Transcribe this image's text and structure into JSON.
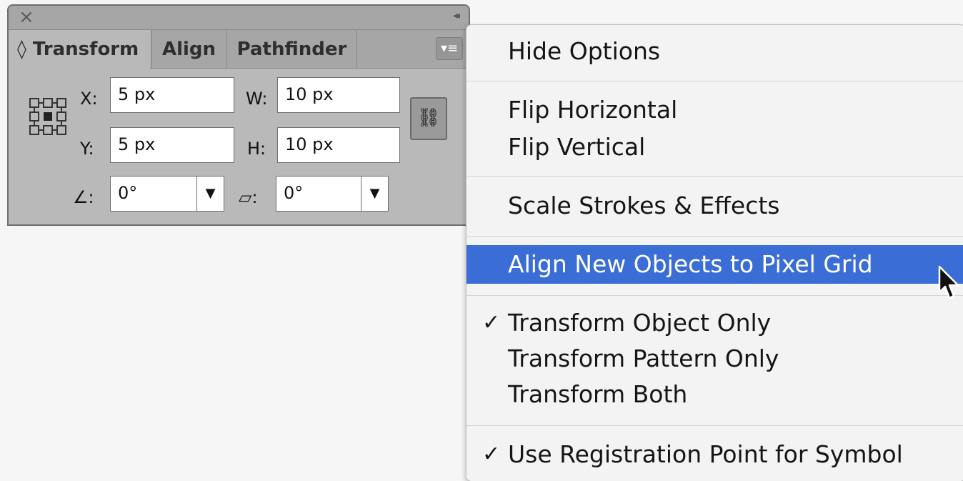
{
  "panel": {
    "close_icon": "×",
    "collapse_icon": "◂◂",
    "tabs": [
      {
        "label": "◊ Transform",
        "active": true
      },
      {
        "label": "Align",
        "active": false
      },
      {
        "label": "Pathfinder",
        "active": false
      }
    ],
    "menu_icon": "▾≡",
    "fields": {
      "x": {
        "label": "X:",
        "value": "5 px"
      },
      "y": {
        "label": "Y:",
        "value": "5 px"
      },
      "w": {
        "label": "W:",
        "value": "10 px"
      },
      "h": {
        "label": "H:",
        "value": "10 px"
      },
      "angle": {
        "label": "∠:",
        "value": "0°"
      },
      "shear": {
        "label": "▱:",
        "value": "0°"
      }
    },
    "dropdown_arrow": "▼",
    "link_icon": "⛓"
  },
  "menu": {
    "items": [
      {
        "label": "Hide Options",
        "checked": false
      },
      {
        "label": "Flip Horizontal",
        "checked": false
      },
      {
        "label": "Flip Vertical",
        "checked": false
      },
      {
        "label": "Scale Strokes & Effects",
        "checked": false
      },
      {
        "label": "Align New Objects to Pixel Grid",
        "checked": false,
        "highlighted": true
      },
      {
        "label": "Transform Object Only",
        "checked": true
      },
      {
        "label": "Transform Pattern Only",
        "checked": false
      },
      {
        "label": "Transform Both",
        "checked": false
      },
      {
        "label": "Use Registration Point for Symbol",
        "checked": true
      }
    ],
    "check_mark": "✓"
  },
  "colors": {
    "highlight": "#3a6dd5",
    "panel_bg": "#b9b9b9"
  }
}
